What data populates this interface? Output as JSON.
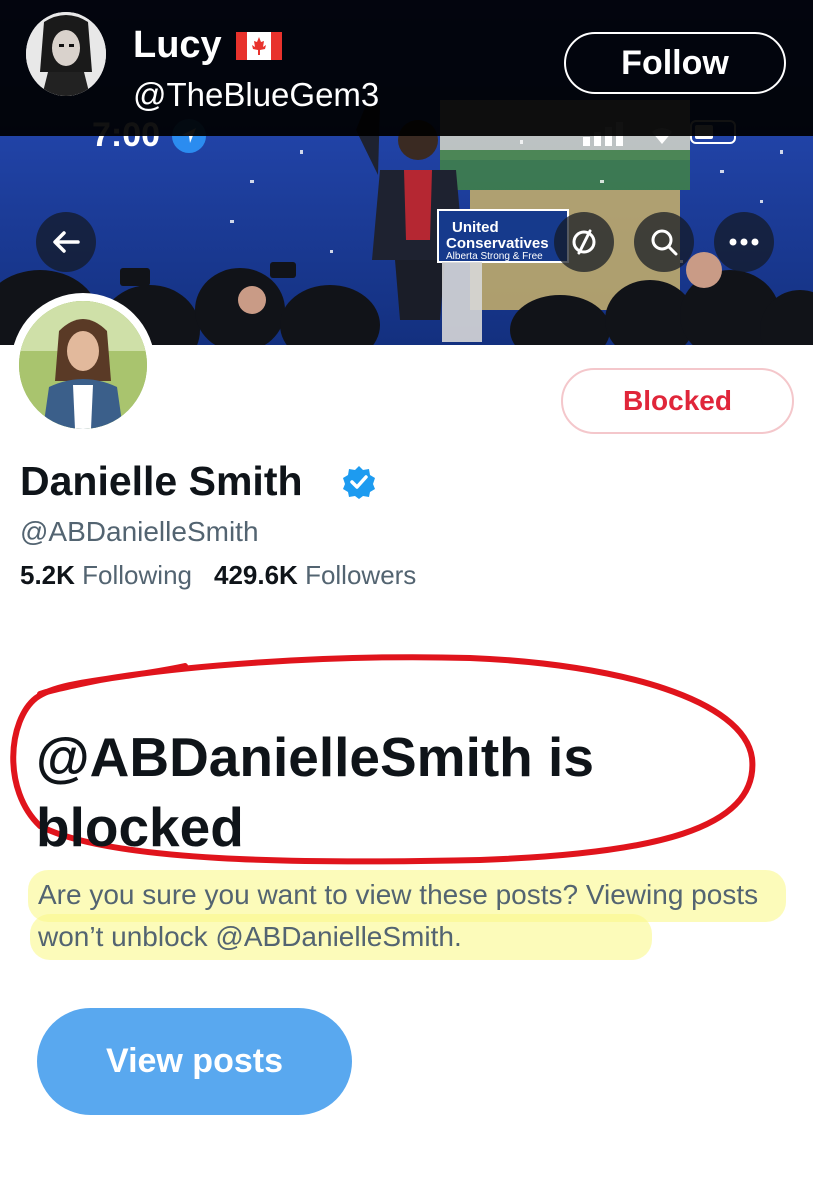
{
  "repost": {
    "name": "Lucy",
    "flag_icon": "canada-flag-icon",
    "handle": "@TheBlueGem3",
    "follow_label": "Follow"
  },
  "status_bar": {
    "time": "7:00"
  },
  "banner": {
    "sign_line1": "United",
    "sign_line2": "Conservatives",
    "sign_line3": "Alberta Strong & Free"
  },
  "profile": {
    "blocked_label": "Blocked",
    "display_name": "Danielle Smith",
    "handle": "@ABDanielleSmith",
    "following_count": "5.2K",
    "following_label": "Following",
    "followers_count": "429.6K",
    "followers_label": "Followers"
  },
  "notice": {
    "title": "@ABDanielleSmith is blocked",
    "message": "Are you sure you want to view these posts? Viewing posts won’t unblock @ABDanielleSmith.",
    "button_label": "View posts"
  },
  "colors": {
    "accent_blue": "#59a8ef",
    "blocked_red": "#e0263a",
    "annotation_red": "#e0141c",
    "highlight_yellow": "#faf88c"
  }
}
